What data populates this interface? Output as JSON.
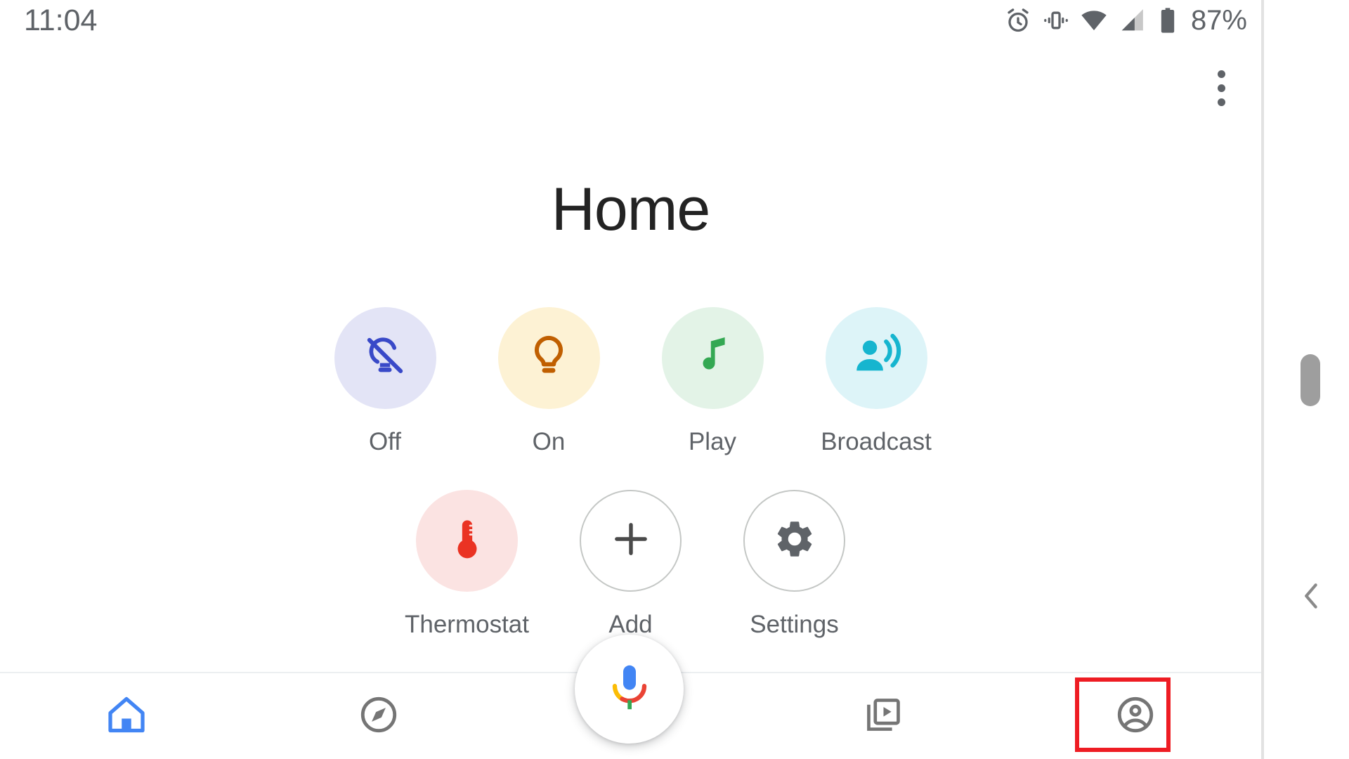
{
  "status_bar": {
    "clock": "11:04",
    "battery_percent": "87%",
    "icons": [
      "alarm-icon",
      "vibrate-icon",
      "wifi-icon",
      "cell-signal-icon",
      "battery-icon"
    ]
  },
  "header": {
    "title": "Home",
    "overflow_menu": "more-options"
  },
  "shortcuts": {
    "row1": [
      {
        "label": "Off",
        "icon": "lightbulb-off-icon",
        "icon_color": "#3949c8",
        "bg": "#e3e4f6"
      },
      {
        "label": "On",
        "icon": "lightbulb-icon",
        "icon_color": "#c05f00",
        "bg": "#fdf2d4"
      },
      {
        "label": "Play",
        "icon": "music-note-icon",
        "icon_color": "#34a853",
        "bg": "#e3f3e7"
      },
      {
        "label": "Broadcast",
        "icon": "broadcast-icon",
        "icon_color": "#16b5cf",
        "bg": "#ddf4f8"
      }
    ],
    "row2": [
      {
        "label": "Thermostat",
        "icon": "thermostat-icon",
        "icon_color": "#ea3323",
        "bg": "#fbe3e2"
      },
      {
        "label": "Add",
        "icon": "plus-icon",
        "icon_color": "#4a4a4a",
        "bg": "outlined"
      },
      {
        "label": "Settings",
        "icon": "gear-icon",
        "icon_color": "#5f6368",
        "bg": "outlined"
      }
    ]
  },
  "assistant": {
    "fab": "google-assistant-mic-icon",
    "colors": {
      "blue": "#4285f4",
      "red": "#ea4335",
      "yellow": "#fbbc05",
      "green": "#34a853"
    }
  },
  "bottom_nav": {
    "items": [
      {
        "label": "Home",
        "icon": "home-icon",
        "active": true,
        "color": "#4285f4"
      },
      {
        "label": "Explore",
        "icon": "compass-icon",
        "active": false,
        "color": "#757575"
      },
      {
        "label": "Media",
        "icon": "media-library-icon",
        "active": false,
        "color": "#757575"
      },
      {
        "label": "Account",
        "icon": "account-circle-icon",
        "active": false,
        "color": "#757575"
      }
    ]
  },
  "right_rail": {
    "scrollbar": "scrollbar-thumb",
    "back": "chevron-left-icon"
  },
  "annotation": {
    "target": "account-nav-button",
    "color": "#ee1c23"
  }
}
